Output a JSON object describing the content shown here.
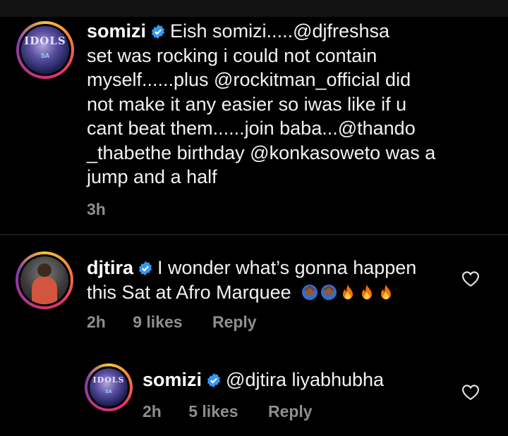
{
  "comments": [
    {
      "username": "somizi",
      "avatar_text": "IDOLS",
      "avatar_sub": "SA",
      "text_lines": [
        "Eish somizi.....@djfreshsa",
        "set was rocking i could not contain",
        "myself......plus @rockitman_official did",
        "not make it any easier so iwas like if u",
        "cant beat them......join baba...@thando",
        "_thabethe birthday @konkasoweto was a",
        "jump and a half"
      ],
      "time": "3h"
    },
    {
      "username": "djtira",
      "text_lines": [
        "I wonder what’s gonna happen",
        "this Sat at Afro Marquee"
      ],
      "emojis": [
        "person-facepalming-emoji",
        "person-facepalming-emoji",
        "fire-emoji",
        "fire-emoji",
        "fire-emoji"
      ],
      "time": "2h",
      "likes": "9 likes",
      "reply_label": "Reply"
    },
    {
      "username": "somizi",
      "avatar_text": "IDOLS",
      "avatar_sub": "SA",
      "text": "@djtira liyabhubha",
      "time": "2h",
      "likes": "5 likes",
      "reply_label": "Reply"
    }
  ],
  "icons": {
    "verified": "verified-badge-icon",
    "like": "heart-outline-icon"
  },
  "colors": {
    "background": "#000000",
    "verified_blue": "#3897f0",
    "meta_gray": "#8e8e8e",
    "fire": "#f5720a"
  }
}
